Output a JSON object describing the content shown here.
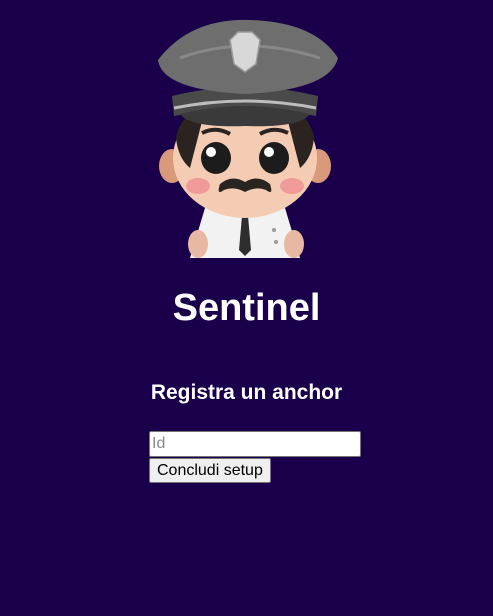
{
  "app": {
    "title": "Sentinel",
    "mascot_icon": "police-officer-mascot-icon"
  },
  "setup": {
    "heading": "Registra un anchor",
    "id_input": {
      "value": "",
      "placeholder": "Id"
    },
    "submit_label": "Concludi setup"
  },
  "colors": {
    "background": "#1a004a",
    "text": "#ffffff"
  }
}
